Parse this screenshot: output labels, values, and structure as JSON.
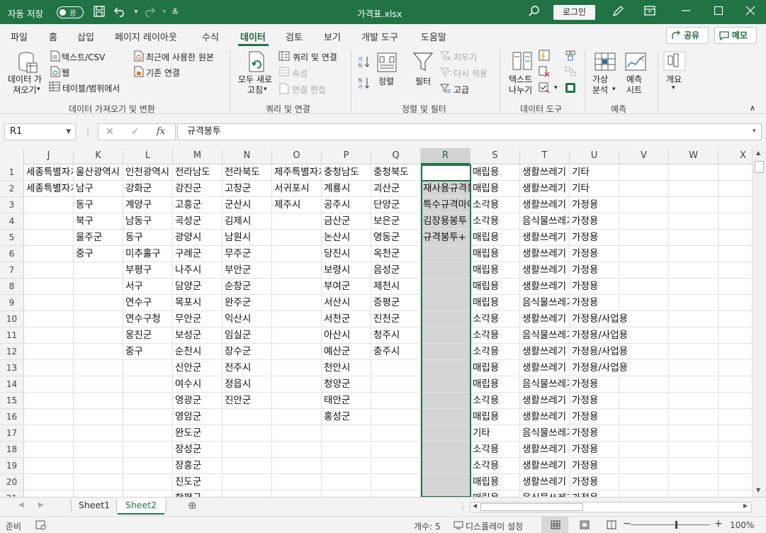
{
  "titlebar": {
    "autosave_label": "자동 저장",
    "autosave_state": "끔",
    "doc_title": "가격표.xlsx",
    "login": "로그인"
  },
  "menu": {
    "tabs": [
      "파일",
      "홈",
      "삽입",
      "페이지 레이아웃",
      "수식",
      "데이터",
      "검토",
      "보기",
      "개발 도구",
      "도움말"
    ],
    "active": "데이터",
    "share": "공유",
    "memo": "메모"
  },
  "ribbon": {
    "get_data": "데이터 가\n져오기",
    "text_csv": "텍스트/CSV",
    "web": "웹",
    "table_range": "테이블/범위에서",
    "recent_sources": "최근에 사용한 원본",
    "existing_conn": "기존 연결",
    "group_get": "데이터 가져오기 및 변환",
    "refresh_all": "모두 새로\n고침",
    "queries_conn": "쿼리 및 연결",
    "properties": "속성",
    "edit_links": "연결 편집",
    "group_query": "쿼리 및 연결",
    "sort": "정렬",
    "filter": "필터",
    "clear": "지우기",
    "reapply": "다시 적용",
    "advanced": "고급",
    "group_sort": "정렬 및 필터",
    "text_to_columns": "텍스트\n나누기",
    "group_tools": "데이터 도구",
    "whatif": "가상\n분석",
    "forecast_sheet": "예측\n시트",
    "group_forecast": "예측",
    "outline": "개요"
  },
  "formula": {
    "name_box": "R1",
    "content": "규격봉투"
  },
  "columns": [
    "J",
    "K",
    "L",
    "M",
    "N",
    "O",
    "P",
    "Q",
    "R",
    "S",
    "T",
    "U",
    "V",
    "W",
    "X"
  ],
  "selected_column": "R",
  "rows": [
    "1",
    "2",
    "3",
    "4",
    "5",
    "6",
    "7",
    "8",
    "9",
    "10",
    "11",
    "12",
    "13",
    "14",
    "15",
    "16",
    "17",
    "18",
    "19",
    "20",
    "21"
  ],
  "cells": {
    "J": [
      "세종특별자치시",
      "세종특별자치시"
    ],
    "K": [
      "울산광역시",
      "남구",
      "동구",
      "북구",
      "울주군",
      "중구"
    ],
    "L": [
      "인천광역시",
      "강화군",
      "계양구",
      "남동구",
      "동구",
      "미추홀구",
      "부평구",
      "서구",
      "연수구",
      "연수구청",
      "옹진군",
      "중구"
    ],
    "M": [
      "전라남도",
      "강진군",
      "고흥군",
      "곡성군",
      "광양시",
      "구례군",
      "나주시",
      "담양군",
      "목포시",
      "무안군",
      "보성군",
      "순천시",
      "신안군",
      "여수시",
      "영광군",
      "영암군",
      "완도군",
      "장성군",
      "장흥군",
      "진도군",
      "함평군"
    ],
    "N": [
      "전라북도",
      "고창군",
      "군산시",
      "김제시",
      "남원시",
      "무주군",
      "부안군",
      "순창군",
      "완주군",
      "익산시",
      "임실군",
      "장수군",
      "전주시",
      "정읍시",
      "진안군"
    ],
    "O": [
      "제주특별자치도",
      "서귀포시",
      "제주시"
    ],
    "P": [
      "충청남도",
      "계룡시",
      "공주시",
      "금산군",
      "논산시",
      "당진시",
      "보령시",
      "부여군",
      "서산시",
      "서천군",
      "아산시",
      "예산군",
      "천안시",
      "청양군",
      "태안군",
      "홍성군"
    ],
    "Q": [
      "충청북도",
      "괴산군",
      "단양군",
      "보은군",
      "영동군",
      "옥천군",
      "음성군",
      "제천시",
      "증평군",
      "진천군",
      "청주시",
      "충주시"
    ],
    "R": [
      "규격봉투",
      "재사용규격봉투",
      "특수규격마대",
      "김장용봉투",
      "규격봉투+"
    ],
    "S": [
      "매립용",
      "매립용",
      "소각용",
      "소각용",
      "매립용",
      "매립용",
      "매립용",
      "매립용",
      "매립용",
      "소각용",
      "소각용",
      "소각용",
      "매립용",
      "매립용",
      "소각용",
      "매립용",
      "기타",
      "소각용",
      "소각용",
      "매립용",
      "매립용"
    ],
    "T": [
      "생활쓰레기",
      "생활쓰레기",
      "생활쓰레기",
      "음식물쓰레기",
      "생활쓰레기",
      "생활쓰레기",
      "생활쓰레기",
      "생활쓰레기",
      "음식물쓰레기",
      "생활쓰레기",
      "음식물쓰레기",
      "생활쓰레기",
      "생활쓰레기",
      "음식물쓰레기",
      "생활쓰레기",
      "생활쓰레기",
      "음식물쓰레기",
      "생활쓰레기",
      "생활쓰레기",
      "생활쓰레기",
      "음식물쓰레기"
    ],
    "U": [
      "기타",
      "기타",
      "가정용",
      "가정용",
      "가정용",
      "가정용",
      "가정용",
      "가정용",
      "가정용",
      "가정용/사업용",
      "가정용/사업용",
      "가정용/사업용",
      "가정용/사업용",
      "가정용",
      "가정용",
      "가정용",
      "가정용",
      "가정용",
      "가정용",
      "가정용",
      "가정용"
    ]
  },
  "sheets": [
    "Sheet1",
    "Sheet2"
  ],
  "active_sheet": "Sheet2",
  "status": {
    "ready": "준비",
    "count": "개수: 5",
    "display_settings": "디스플레이 설정",
    "zoom": "100%"
  },
  "colors": {
    "accent": "#217346",
    "selected_column_bg": "#d4d4d4"
  }
}
